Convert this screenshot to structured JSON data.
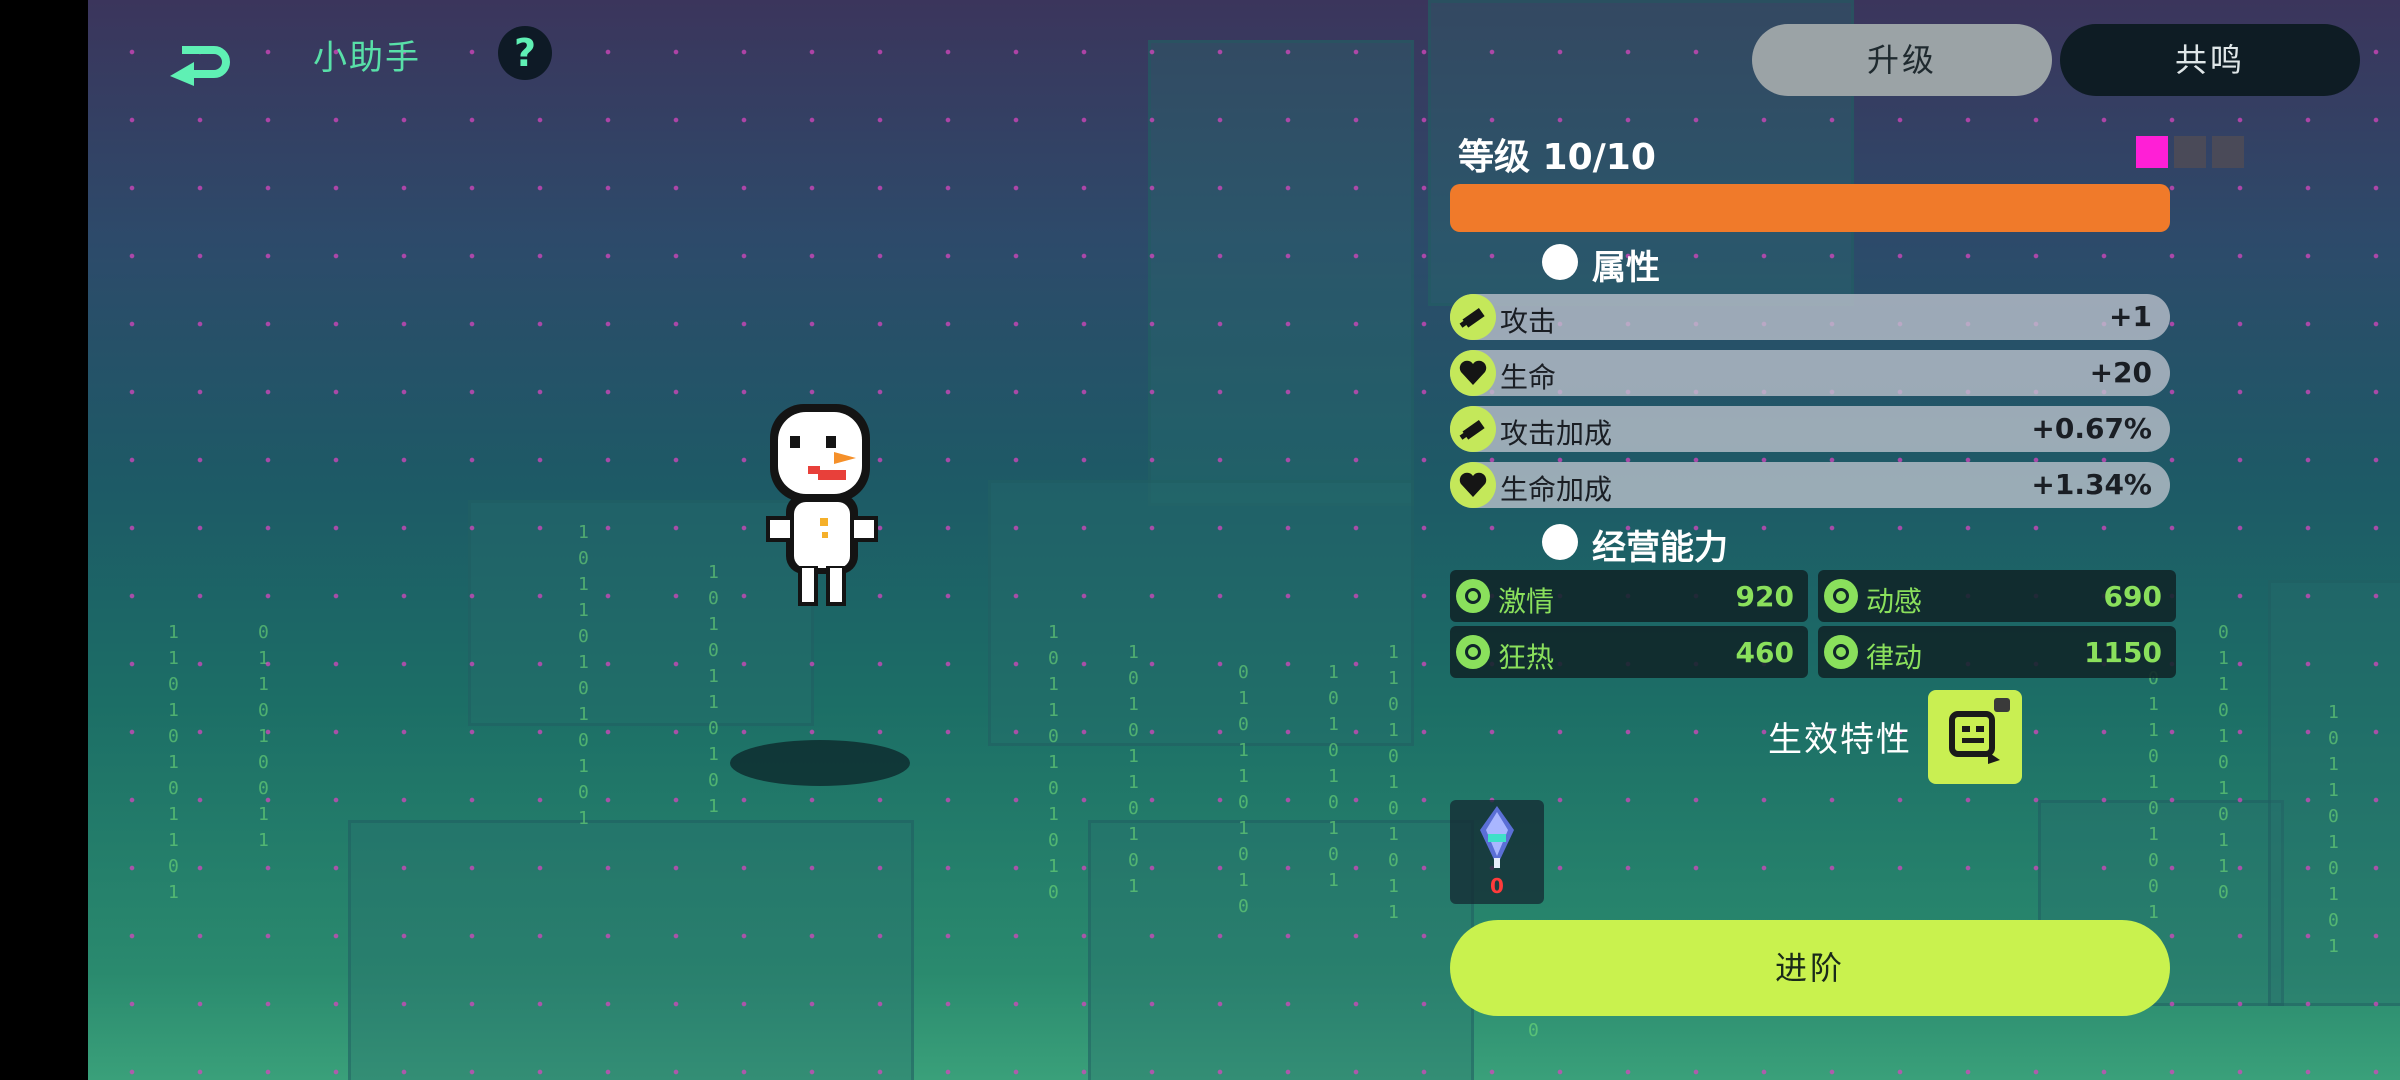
{
  "top_left": {
    "helper_label": "小助手",
    "help_label": "?"
  },
  "tabs": [
    {
      "label": "升级",
      "active": true
    },
    {
      "label": "共鸣",
      "active": false
    }
  ],
  "level": {
    "text": "等级 10/10",
    "current": 10,
    "max": 10,
    "progress": 1.0,
    "bar_color": "#f07a2a",
    "stars": [
      "#ff1fd6",
      "#4a4a58",
      "#4a4a58"
    ]
  },
  "attributes": {
    "title": "属性",
    "rows": [
      {
        "icon": "sword-icon",
        "label": "攻击",
        "value": "+1"
      },
      {
        "icon": "heart-icon",
        "label": "生命",
        "value": "+20"
      },
      {
        "icon": "sword-icon",
        "label": "攻击加成",
        "value": "+0.67%"
      },
      {
        "icon": "heart-icon",
        "label": "生命加成",
        "value": "+1.34%"
      }
    ]
  },
  "business": {
    "title": "经营能力",
    "cells": [
      {
        "label": "激情",
        "value": "920"
      },
      {
        "label": "动感",
        "value": "690"
      },
      {
        "label": "狂热",
        "value": "460"
      },
      {
        "label": "律动",
        "value": "1150"
      }
    ]
  },
  "trait": {
    "label": "生效特性",
    "icon": "mask-trait-icon"
  },
  "item": {
    "icon": "crystal-icon",
    "count": "0"
  },
  "advance_button": "进阶",
  "colors": {
    "accent": "#c9f24e",
    "business_text": "#8ae05c"
  }
}
